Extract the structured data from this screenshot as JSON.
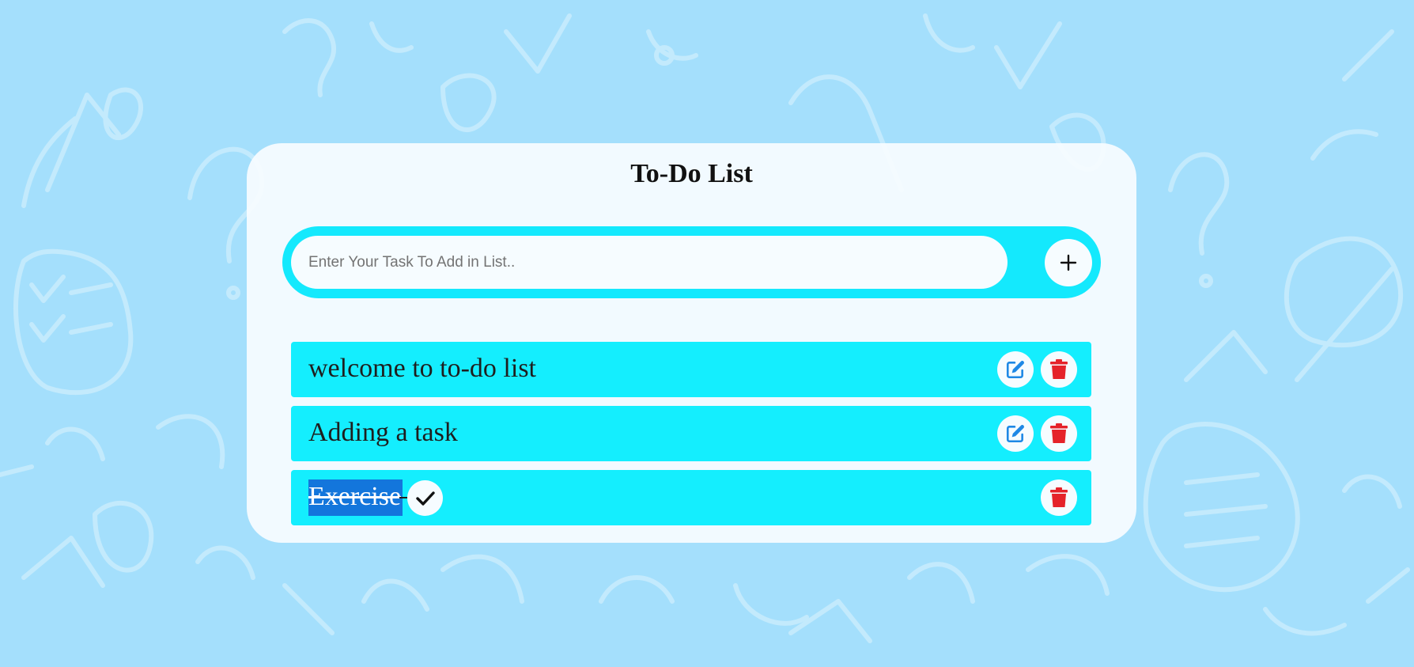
{
  "app": {
    "title": "To-Do List"
  },
  "input": {
    "placeholder": "Enter Your Task To Add in List..",
    "value": ""
  },
  "add_button": {
    "icon": "plus-icon"
  },
  "tasks": [
    {
      "text": "welcome to to-do list",
      "completed": false,
      "actions": [
        "edit-icon",
        "trash-icon"
      ]
    },
    {
      "text": "Adding a task",
      "completed": false,
      "actions": [
        "edit-icon",
        "trash-icon"
      ]
    },
    {
      "text": "Exercise",
      "completed": true,
      "actions": [
        "check-icon",
        "trash-icon"
      ]
    }
  ],
  "colors": {
    "background": "#a4dffc",
    "card": "#f6fcff",
    "accent": "#14e9fd",
    "edit_icon": "#1e88e5",
    "delete_icon": "#e5232a",
    "selection": "#1376dc"
  }
}
